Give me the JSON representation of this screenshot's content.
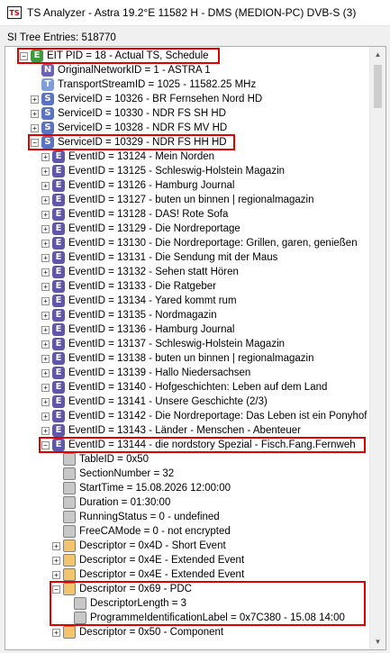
{
  "window": {
    "title": "TS Analyzer - Astra 19.2°E 11582 H - DMS (MEDION-PC) DVB-S (3)"
  },
  "entries_label": "SI Tree Entries: 518770",
  "colors": {
    "E": "#5f57a8",
    "N": "#6b63b5",
    "T": "#7f9ed9",
    "S": "#5a74c2",
    "G": "#3e9a3e",
    "leaf": "#c8c8c8",
    "folder": "#f2c46e"
  },
  "tree": [
    {
      "text": "EIT PID = 18 - Actual TS, Schedule",
      "icon": "E",
      "color": "G",
      "exp": "-",
      "level": 0
    },
    {
      "text": "OriginalNetworkID = 1 - ASTRA 1",
      "icon": "N",
      "color": "N",
      "exp": "",
      "level": 1
    },
    {
      "text": "TransportStreamID = 1025 - 11582.25 MHz",
      "icon": "T",
      "color": "T",
      "exp": "",
      "level": 1
    },
    {
      "text": "ServiceID = 10326 - BR Fernsehen Nord HD",
      "icon": "S",
      "color": "S",
      "exp": "+",
      "level": 1
    },
    {
      "text": "ServiceID = 10330 - NDR FS SH HD",
      "icon": "S",
      "color": "S",
      "exp": "+",
      "level": 1
    },
    {
      "text": "ServiceID = 10328 - NDR FS MV HD",
      "icon": "S",
      "color": "S",
      "exp": "+",
      "level": 1
    },
    {
      "text": "ServiceID = 10329 - NDR FS HH HD",
      "icon": "S",
      "color": "S",
      "exp": "-",
      "level": 1
    },
    {
      "text": "EventID = 13124 - Mein Norden",
      "icon": "E",
      "color": "E",
      "exp": "+",
      "level": 2
    },
    {
      "text": "EventID = 13125 - Schleswig-Holstein Magazin",
      "icon": "E",
      "color": "E",
      "exp": "+",
      "level": 2
    },
    {
      "text": "EventID = 13126 - Hamburg Journal",
      "icon": "E",
      "color": "E",
      "exp": "+",
      "level": 2
    },
    {
      "text": "EventID = 13127 - buten un binnen | regionalmagazin",
      "icon": "E",
      "color": "E",
      "exp": "+",
      "level": 2
    },
    {
      "text": "EventID = 13128 - DAS! Rote Sofa",
      "icon": "E",
      "color": "E",
      "exp": "+",
      "level": 2
    },
    {
      "text": "EventID = 13129 - Die Nordreportage",
      "icon": "E",
      "color": "E",
      "exp": "+",
      "level": 2
    },
    {
      "text": "EventID = 13130 - Die Nordreportage: Grillen, garen, genießen",
      "icon": "E",
      "color": "E",
      "exp": "+",
      "level": 2
    },
    {
      "text": "EventID = 13131 - Die Sendung mit der Maus",
      "icon": "E",
      "color": "E",
      "exp": "+",
      "level": 2
    },
    {
      "text": "EventID = 13132 - Sehen statt Hören",
      "icon": "E",
      "color": "E",
      "exp": "+",
      "level": 2
    },
    {
      "text": "EventID = 13133 - Die Ratgeber",
      "icon": "E",
      "color": "E",
      "exp": "+",
      "level": 2
    },
    {
      "text": "EventID = 13134 - Yared kommt rum",
      "icon": "E",
      "color": "E",
      "exp": "+",
      "level": 2
    },
    {
      "text": "EventID = 13135 - Nordmagazin",
      "icon": "E",
      "color": "E",
      "exp": "+",
      "level": 2
    },
    {
      "text": "EventID = 13136 - Hamburg Journal",
      "icon": "E",
      "color": "E",
      "exp": "+",
      "level": 2
    },
    {
      "text": "EventID = 13137 - Schleswig-Holstein Magazin",
      "icon": "E",
      "color": "E",
      "exp": "+",
      "level": 2
    },
    {
      "text": "EventID = 13138 - buten un binnen | regionalmagazin",
      "icon": "E",
      "color": "E",
      "exp": "+",
      "level": 2
    },
    {
      "text": "EventID = 13139 - Hallo Niedersachsen",
      "icon": "E",
      "color": "E",
      "exp": "+",
      "level": 2
    },
    {
      "text": "EventID = 13140 - Hofgeschichten: Leben auf dem Land",
      "icon": "E",
      "color": "E",
      "exp": "+",
      "level": 2
    },
    {
      "text": "EventID = 13141 - Unsere Geschichte (2/3)",
      "icon": "E",
      "color": "E",
      "exp": "+",
      "level": 2
    },
    {
      "text": "EventID = 13142 - Die Nordreportage: Das Leben ist ein Ponyhof",
      "icon": "E",
      "color": "E",
      "exp": "+",
      "level": 2
    },
    {
      "text": "EventID = 13143 - Länder - Menschen - Abenteuer",
      "icon": "E",
      "color": "E",
      "exp": "+",
      "level": 2
    },
    {
      "text": "EventID = 13144 - die nordstory Spezial - Fisch.Fang.Fernweh",
      "icon": "E",
      "color": "E",
      "exp": "-",
      "level": 2
    },
    {
      "text": "TableID = 0x50",
      "icon": "",
      "color": "leaf",
      "exp": "",
      "level": 3
    },
    {
      "text": "SectionNumber = 32",
      "icon": "",
      "color": "leaf",
      "exp": "",
      "level": 3
    },
    {
      "text": "StartTime = 15.08.2026 12:00:00",
      "icon": "",
      "color": "leaf",
      "exp": "",
      "level": 3
    },
    {
      "text": "Duration = 01:30:00",
      "icon": "",
      "color": "leaf",
      "exp": "",
      "level": 3
    },
    {
      "text": "RunningStatus = 0 - undefined",
      "icon": "",
      "color": "leaf",
      "exp": "",
      "level": 3
    },
    {
      "text": "FreeCAMode = 0 - not encrypted",
      "icon": "",
      "color": "leaf",
      "exp": "",
      "level": 3
    },
    {
      "text": "Descriptor = 0x4D - Short Event",
      "icon": "",
      "color": "folder",
      "exp": "+",
      "level": 3
    },
    {
      "text": "Descriptor = 0x4E - Extended Event",
      "icon": "",
      "color": "folder",
      "exp": "+",
      "level": 3
    },
    {
      "text": "Descriptor = 0x4E - Extended Event",
      "icon": "",
      "color": "folder",
      "exp": "+",
      "level": 3
    },
    {
      "text": "Descriptor = 0x69 - PDC",
      "icon": "",
      "color": "folder",
      "exp": "-",
      "level": 3
    },
    {
      "text": "DescriptorLength = 3",
      "icon": "",
      "color": "leaf",
      "exp": "",
      "level": 4
    },
    {
      "text": "ProgrammeIdentificationLabel = 0x7C380 - 15.08 14:00",
      "icon": "",
      "color": "leaf",
      "exp": "",
      "level": 4
    },
    {
      "text": "Descriptor = 0x50 - Component",
      "icon": "",
      "color": "folder",
      "exp": "+",
      "level": 3
    }
  ],
  "highlighted_rows": [
    0,
    6,
    27,
    37,
    38,
    39
  ]
}
